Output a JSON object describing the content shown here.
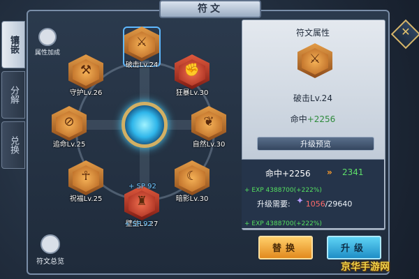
{
  "header": {
    "title": "符文"
  },
  "side_tabs": [
    {
      "label": "镶嵌",
      "active": true
    },
    {
      "label": "分解",
      "active": false
    },
    {
      "label": "兑换",
      "active": false
    }
  ],
  "attr_bonus_label": "属性加成",
  "overview_label": "符文总览",
  "runes": [
    {
      "name": "破击Lv.24",
      "glyph": "⚔",
      "color": "orange",
      "selected": true
    },
    {
      "name": "守护Lv.26",
      "glyph": "⚒",
      "color": "orange",
      "selected": false
    },
    {
      "name": "狂暴Lv.30",
      "glyph": "✊",
      "color": "red",
      "selected": false
    },
    {
      "name": "追命Lv.25",
      "glyph": "⊘",
      "color": "orange",
      "selected": false
    },
    {
      "name": "自然Lv.30",
      "glyph": "❦",
      "color": "orange",
      "selected": false
    },
    {
      "name": "祝福Lv.25",
      "glyph": "☥",
      "color": "orange",
      "selected": false
    },
    {
      "name": "暗影Lv.30",
      "glyph": "☾",
      "color": "orange",
      "selected": false
    },
    {
      "name": "壁垒Lv.27",
      "glyph": "♜",
      "color": "red",
      "selected": false
    }
  ],
  "sp_bonus": "+ SP 92",
  "panel": {
    "title": "符文属性",
    "rune_name": "破击Lv.24",
    "stat_label": "命中",
    "stat_value": "+2256",
    "preview_label": "升级预览",
    "current": "命中+2256",
    "next": "2341",
    "exp_text": "+ EXP 4388700(+222%)",
    "need_label": "升级需要:",
    "need_current": "1056",
    "need_total": "/29640"
  },
  "buttons": {
    "replace": "替换",
    "upgrade": "升级"
  },
  "watermark": "京华手游网"
}
